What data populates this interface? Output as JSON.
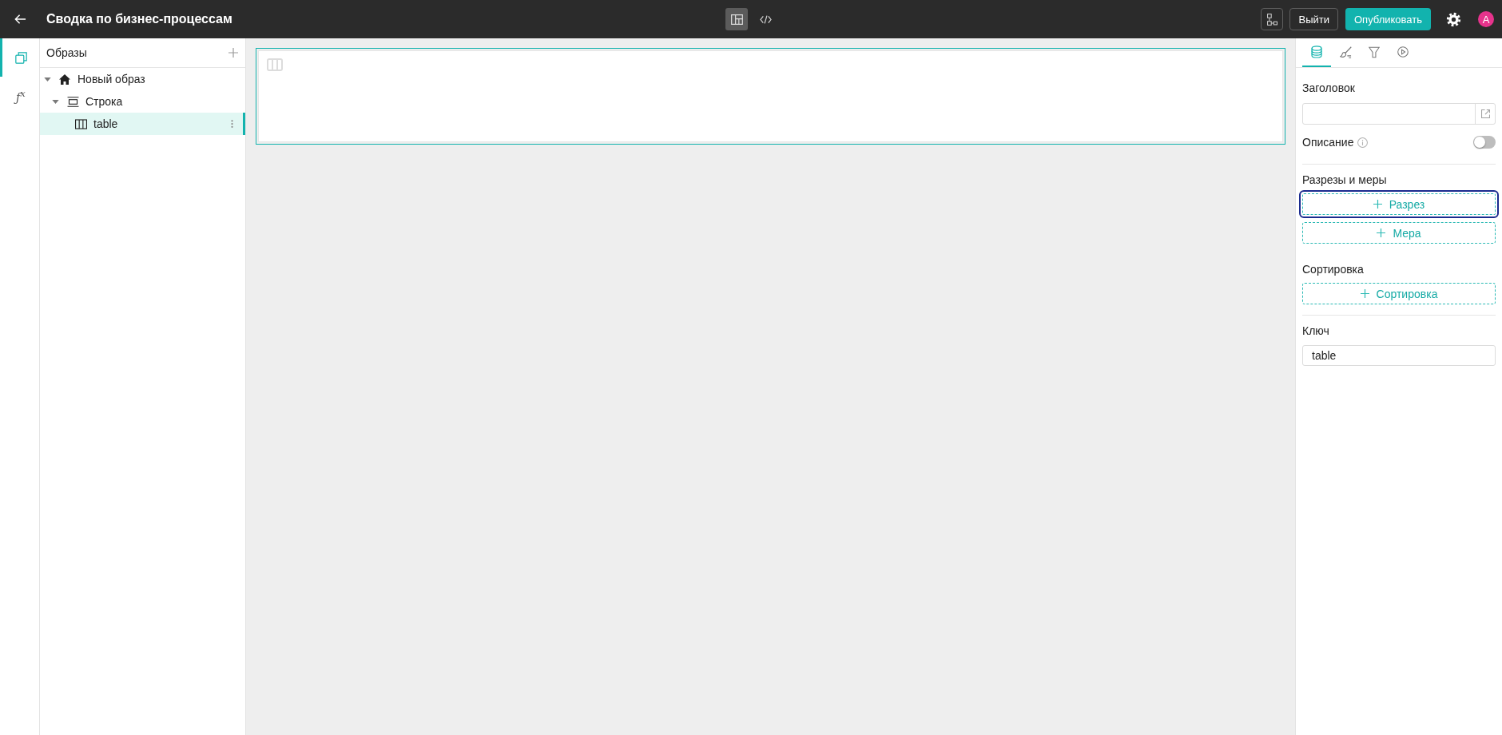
{
  "top_bar": {
    "title": "Сводка по бизнес-процессам",
    "view_modes": [
      {
        "kind": "layout",
        "selected": true
      },
      {
        "kind": "code",
        "selected": false
      }
    ],
    "exit_button": "Выйти",
    "publish_button": "Опубликовать",
    "avatar": "A"
  },
  "rail": [
    {
      "kind": "pages",
      "selected": true
    },
    {
      "kind": "formula",
      "glyph": "ƒ$^{x}$",
      "selected": false
    }
  ],
  "tree": {
    "title": "Образы",
    "items": [
      {
        "kind": "page",
        "label": "Новый образ",
        "expanded": true,
        "selected": false,
        "children": [
          {
            "kind": "row",
            "label": "Строка",
            "expanded": true,
            "selected": false,
            "children": [
              {
                "kind": "table",
                "label": "table",
                "selected": true
              }
            ]
          }
        ]
      }
    ]
  },
  "canvas": {
    "widgets": [
      {
        "kind": "table",
        "selected": true
      }
    ]
  },
  "properties": {
    "tabs": [
      {
        "kind": "data",
        "selected": true
      },
      {
        "kind": "style",
        "selected": false
      },
      {
        "kind": "filter",
        "selected": false
      },
      {
        "kind": "actions",
        "selected": false
      }
    ],
    "title_field": {
      "label": "Заголовок"
    },
    "description": {
      "label": "Описание",
      "on": false
    },
    "sections": [
      {
        "label": "Разрезы и меры",
        "buttons": [
          {
            "label": "Разрез",
            "focused": true
          },
          {
            "label": "Мера",
            "focused": false
          }
        ]
      },
      {
        "label": "Сортировка",
        "buttons": [
          {
            "label": "Сортировка",
            "focused": false
          }
        ]
      }
    ],
    "key_field": {
      "label": "Ключ",
      "value": "table"
    }
  }
}
